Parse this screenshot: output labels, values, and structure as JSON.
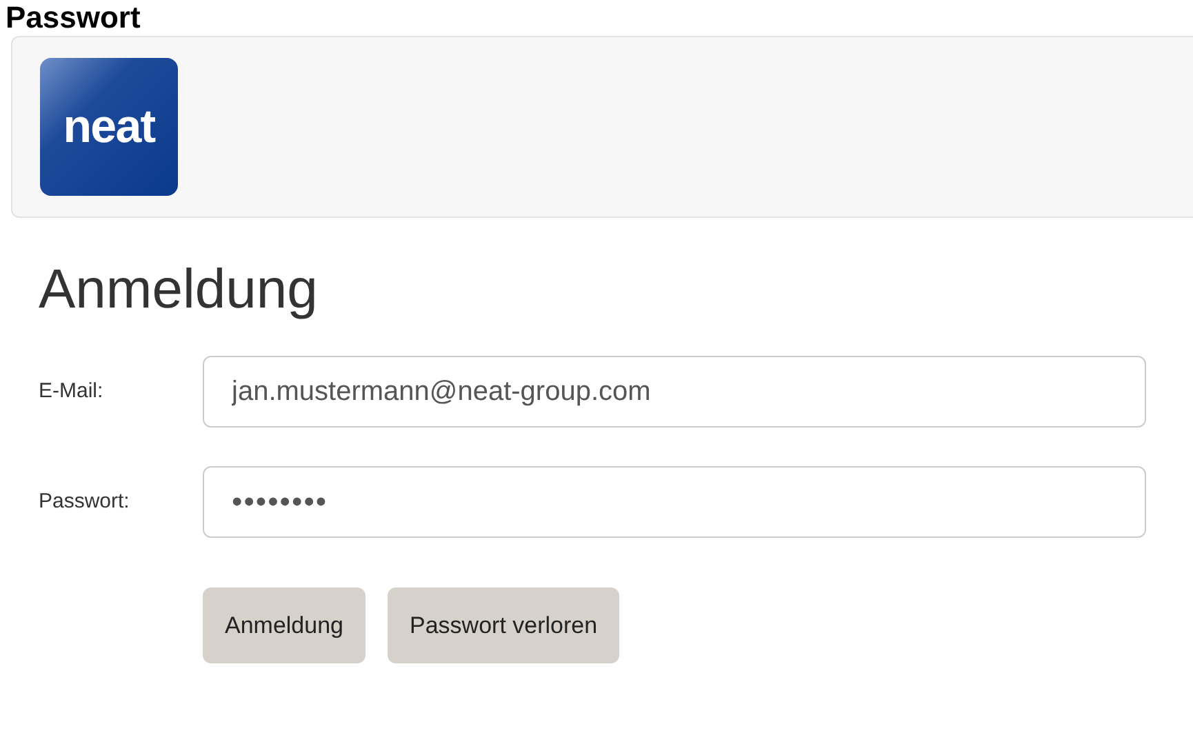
{
  "page_heading": "Passwort",
  "header": {
    "logo": "neat"
  },
  "form": {
    "title": "Anmeldung",
    "fields": [
      {
        "label": "E-Mail:",
        "value": "jan.mustermann@neat-group.com",
        "kind": "text"
      },
      {
        "label": "Passwort:",
        "value": "••••••••",
        "kind": "password"
      }
    ],
    "buttons": [
      "Anmeldung",
      "Passwort verloren"
    ]
  }
}
